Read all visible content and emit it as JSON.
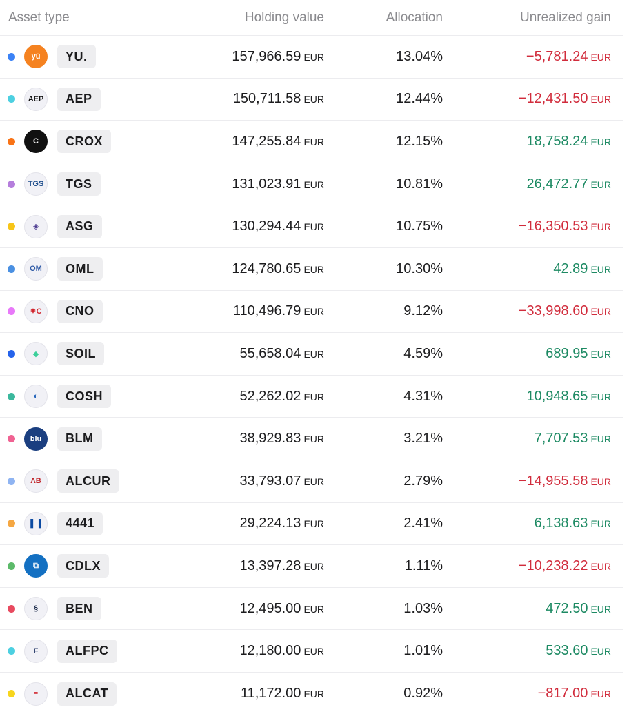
{
  "header": {
    "asset_type": "Asset type",
    "holding_value": "Holding value",
    "allocation": "Allocation",
    "unrealized_gain": "Unrealized gain"
  },
  "currency": "EUR",
  "rows": [
    {
      "ticker": "YU.",
      "value": "157,966.59",
      "alloc": "13.04%",
      "gain": "−5,781.24",
      "gain_sign": "neg",
      "dot": "#3b82f6",
      "logo": "yu-logo-icon",
      "logo_text": "yü",
      "logo_bg": "#f58220",
      "logo_fg": "#ffffff"
    },
    {
      "ticker": "AEP",
      "value": "150,711.58",
      "alloc": "12.44%",
      "gain": "−12,431.50",
      "gain_sign": "neg",
      "dot": "#4dd0e1",
      "logo": "aep-logo-icon",
      "logo_text": "AEP",
      "logo_bg": "#f1f1f6",
      "logo_fg": "#111111"
    },
    {
      "ticker": "CROX",
      "value": "147,255.84",
      "alloc": "12.15%",
      "gain": "18,758.24",
      "gain_sign": "pos",
      "dot": "#f97316",
      "logo": "crox-logo-icon",
      "logo_text": "C",
      "logo_bg": "#111111",
      "logo_fg": "#ffffff"
    },
    {
      "ticker": "TGS",
      "value": "131,023.91",
      "alloc": "10.81%",
      "gain": "26,472.77",
      "gain_sign": "pos",
      "dot": "#b57edc",
      "logo": "tgs-logo-icon",
      "logo_text": "TGS",
      "logo_bg": "#f1f1f6",
      "logo_fg": "#1e4e8c"
    },
    {
      "ticker": "ASG",
      "value": "130,294.44",
      "alloc": "10.75%",
      "gain": "−16,350.53",
      "gain_sign": "neg",
      "dot": "#f7c518",
      "logo": "asg-logo-icon",
      "logo_text": "◈",
      "logo_bg": "#f1f1f6",
      "logo_fg": "#4b3a8f"
    },
    {
      "ticker": "OML",
      "value": "124,780.65",
      "alloc": "10.30%",
      "gain": "42.89",
      "gain_sign": "pos",
      "dot": "#4a90e2",
      "logo": "oml-logo-icon",
      "logo_text": "OM",
      "logo_bg": "#f1f1f6",
      "logo_fg": "#2f5aa6"
    },
    {
      "ticker": "CNO",
      "value": "110,496.79",
      "alloc": "9.12%",
      "gain": "−33,998.60",
      "gain_sign": "neg",
      "dot": "#e879f9",
      "logo": "cno-logo-icon",
      "logo_text": "✹C",
      "logo_bg": "#f1f1f6",
      "logo_fg": "#d1262f"
    },
    {
      "ticker": "SOIL",
      "value": "55,658.04",
      "alloc": "4.59%",
      "gain": "689.95",
      "gain_sign": "pos",
      "dot": "#2563eb",
      "logo": "soil-logo-icon",
      "logo_text": "◆",
      "logo_bg": "#f1f1f6",
      "logo_fg": "#3ccf9a"
    },
    {
      "ticker": "COSH",
      "value": "52,262.02",
      "alloc": "4.31%",
      "gain": "10,948.65",
      "gain_sign": "pos",
      "dot": "#3bb89d",
      "logo": "cosh-logo-icon",
      "logo_text": "◐",
      "logo_bg": "#f1f1f6",
      "logo_fg": "#1d5fb8"
    },
    {
      "ticker": "BLM",
      "value": "38,929.83",
      "alloc": "3.21%",
      "gain": "7,707.53",
      "gain_sign": "pos",
      "dot": "#f06292",
      "logo": "blm-logo-icon",
      "logo_text": "blu",
      "logo_bg": "#1b3f80",
      "logo_fg": "#ffffff"
    },
    {
      "ticker": "ALCUR",
      "value": "33,793.07",
      "alloc": "2.79%",
      "gain": "−14,955.58",
      "gain_sign": "neg",
      "dot": "#8fb4f2",
      "logo": "alcur-logo-icon",
      "logo_text": "ΛB",
      "logo_bg": "#f1f1f6",
      "logo_fg": "#c1272d"
    },
    {
      "ticker": "4441",
      "value": "29,224.13",
      "alloc": "2.41%",
      "gain": "6,138.63",
      "gain_sign": "pos",
      "dot": "#f5a742",
      "logo": "4441-logo-icon",
      "logo_text": "▌▐",
      "logo_bg": "#f1f1f6",
      "logo_fg": "#0b4aa2"
    },
    {
      "ticker": "CDLX",
      "value": "13,397.28",
      "alloc": "1.11%",
      "gain": "−10,238.22",
      "gain_sign": "neg",
      "dot": "#5cba6a",
      "logo": "cdlx-logo-icon",
      "logo_text": "⧉",
      "logo_bg": "#1370c2",
      "logo_fg": "#ffffff"
    },
    {
      "ticker": "BEN",
      "value": "12,495.00",
      "alloc": "1.03%",
      "gain": "472.50",
      "gain_sign": "pos",
      "dot": "#e84a5f",
      "logo": "ben-logo-icon",
      "logo_text": "§",
      "logo_bg": "#f1f1f6",
      "logo_fg": "#1b2a4a"
    },
    {
      "ticker": "ALFPC",
      "value": "12,180.00",
      "alloc": "1.01%",
      "gain": "533.60",
      "gain_sign": "pos",
      "dot": "#4dd0e1",
      "logo": "alfpc-logo-icon",
      "logo_text": "F",
      "logo_bg": "#f1f1f6",
      "logo_fg": "#2a3d6b"
    },
    {
      "ticker": "ALCAT",
      "value": "11,172.00",
      "alloc": "0.92%",
      "gain": "−817.00",
      "gain_sign": "neg",
      "dot": "#f7d51d",
      "logo": "alcat-logo-icon",
      "logo_text": "≡",
      "logo_bg": "#f1f1f6",
      "logo_fg": "#d1262f"
    }
  ]
}
